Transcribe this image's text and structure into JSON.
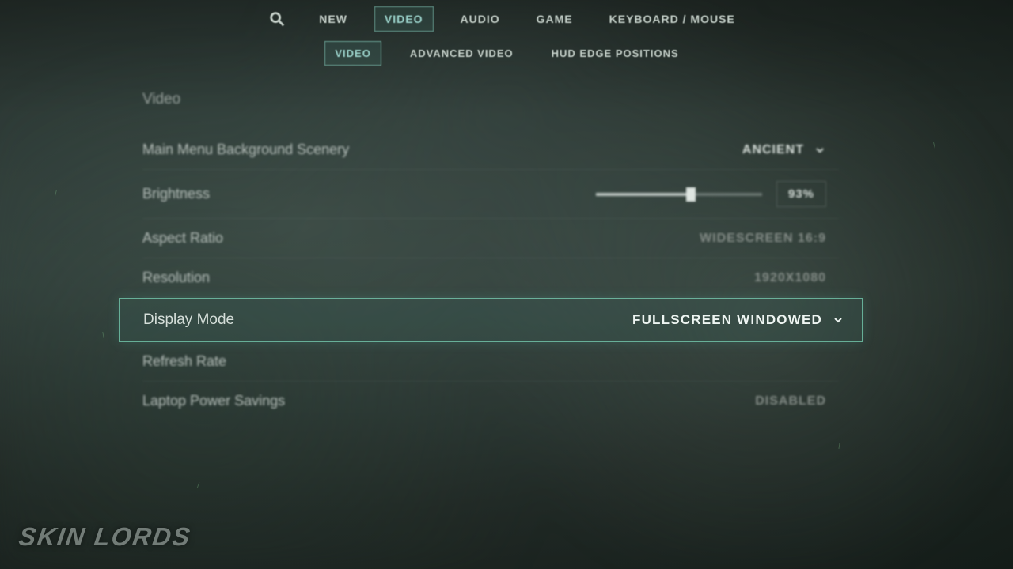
{
  "mainTabs": {
    "new": "NEW",
    "video": "VIDEO",
    "audio": "AUDIO",
    "game": "GAME",
    "keyboard": "KEYBOARD / MOUSE"
  },
  "subTabs": {
    "video": "VIDEO",
    "advanced": "ADVANCED VIDEO",
    "hud": "HUD EDGE POSITIONS"
  },
  "section": {
    "title": "Video"
  },
  "settings": {
    "scenery": {
      "label": "Main Menu Background Scenery",
      "value": "ANCIENT"
    },
    "brightness": {
      "label": "Brightness",
      "value": "93%",
      "percent": 57
    },
    "aspect": {
      "label": "Aspect Ratio",
      "value": "WIDESCREEN 16:9"
    },
    "resolution": {
      "label": "Resolution",
      "value": "1920X1080"
    },
    "display": {
      "label": "Display Mode",
      "value": "FULLSCREEN WINDOWED"
    },
    "refresh": {
      "label": "Refresh Rate",
      "value": ""
    },
    "power": {
      "label": "Laptop Power Savings",
      "value": "DISABLED"
    }
  },
  "watermark": "SKIN LORDS"
}
